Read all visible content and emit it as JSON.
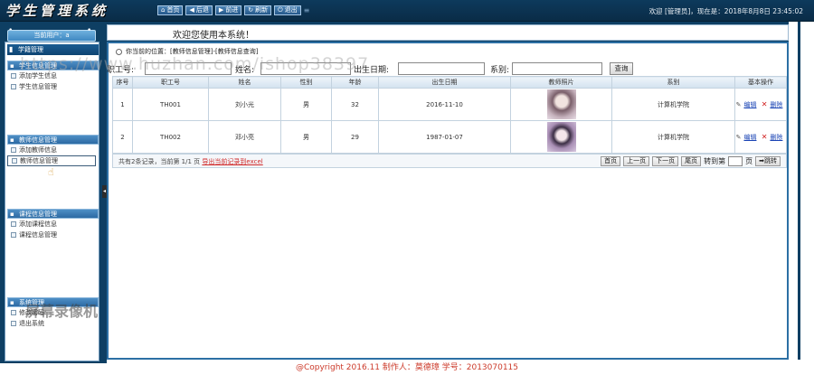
{
  "header": {
    "logo": "学生管理系统",
    "nav": [
      {
        "icon": "home-icon",
        "glyph": "⌂",
        "label": "首页"
      },
      {
        "icon": "back-icon",
        "glyph": "◀",
        "label": "后退"
      },
      {
        "icon": "forward-icon",
        "glyph": "▶",
        "label": "前进"
      },
      {
        "icon": "refresh-icon",
        "glyph": "↻",
        "label": "刷新"
      },
      {
        "icon": "logout-icon",
        "glyph": "⏻",
        "label": "退出"
      }
    ],
    "welcome": "欢迎 [管理员]，现在是：2018年8月8日 23:45:02"
  },
  "subbar": {
    "current_user": "当前用户：a",
    "welcome_msg": "欢迎您使用本系统！"
  },
  "sidebar": {
    "top_head": "学籍管理",
    "groups": [
      {
        "title": "学生信息管理",
        "items": [
          "添加学生信息",
          "学生信息管理"
        ]
      },
      {
        "title": "教师信息管理",
        "items": [
          "添加教师信息",
          "教师信息管理"
        ]
      },
      {
        "title": "课程信息管理",
        "items": [
          "添加课程信息",
          "课程信息管理"
        ]
      },
      {
        "title": "系统管理",
        "items": [
          "修改密码",
          "退出系统"
        ]
      }
    ]
  },
  "main": {
    "breadcrumb": "你当前的位置：[教师信息管理]-[教师信息查询]",
    "search": {
      "id_label": "职工号:",
      "name_label": "姓名:",
      "birth_label": "出生日期:",
      "dept_label": "系别:",
      "button": "查询"
    },
    "columns": [
      "序号",
      "职工号",
      "姓名",
      "性别",
      "年龄",
      "出生日期",
      "教师照片",
      "系别",
      "基本操作"
    ],
    "rows": [
      {
        "no": "1",
        "id": "TH001",
        "name": "刘小光",
        "gender": "男",
        "age": "32",
        "birth": "2016-11-10",
        "dept": "计算机学院",
        "edit": "编辑",
        "delete": "删除"
      },
      {
        "no": "2",
        "id": "TH002",
        "name": "邓小亮",
        "gender": "男",
        "age": "29",
        "birth": "1987-01-07",
        "dept": "计算机学院",
        "edit": "编辑",
        "delete": "删除"
      }
    ],
    "pager": {
      "info": "共有2条记录，当前第 1/1 页",
      "export": "导出当前记录到excel",
      "first": "首页",
      "prev": "上一页",
      "next": "下一页",
      "last": "尾页",
      "goto": "转到第",
      "page_unit": "页",
      "go": "跳转"
    }
  },
  "footer": "@Copyright 2016.11  制作人：莫德璋  学号：2013070115",
  "overlay": {
    "watermark": "https://www.huzhan.com/ishop38397",
    "recorder": "屏幕录像机"
  }
}
